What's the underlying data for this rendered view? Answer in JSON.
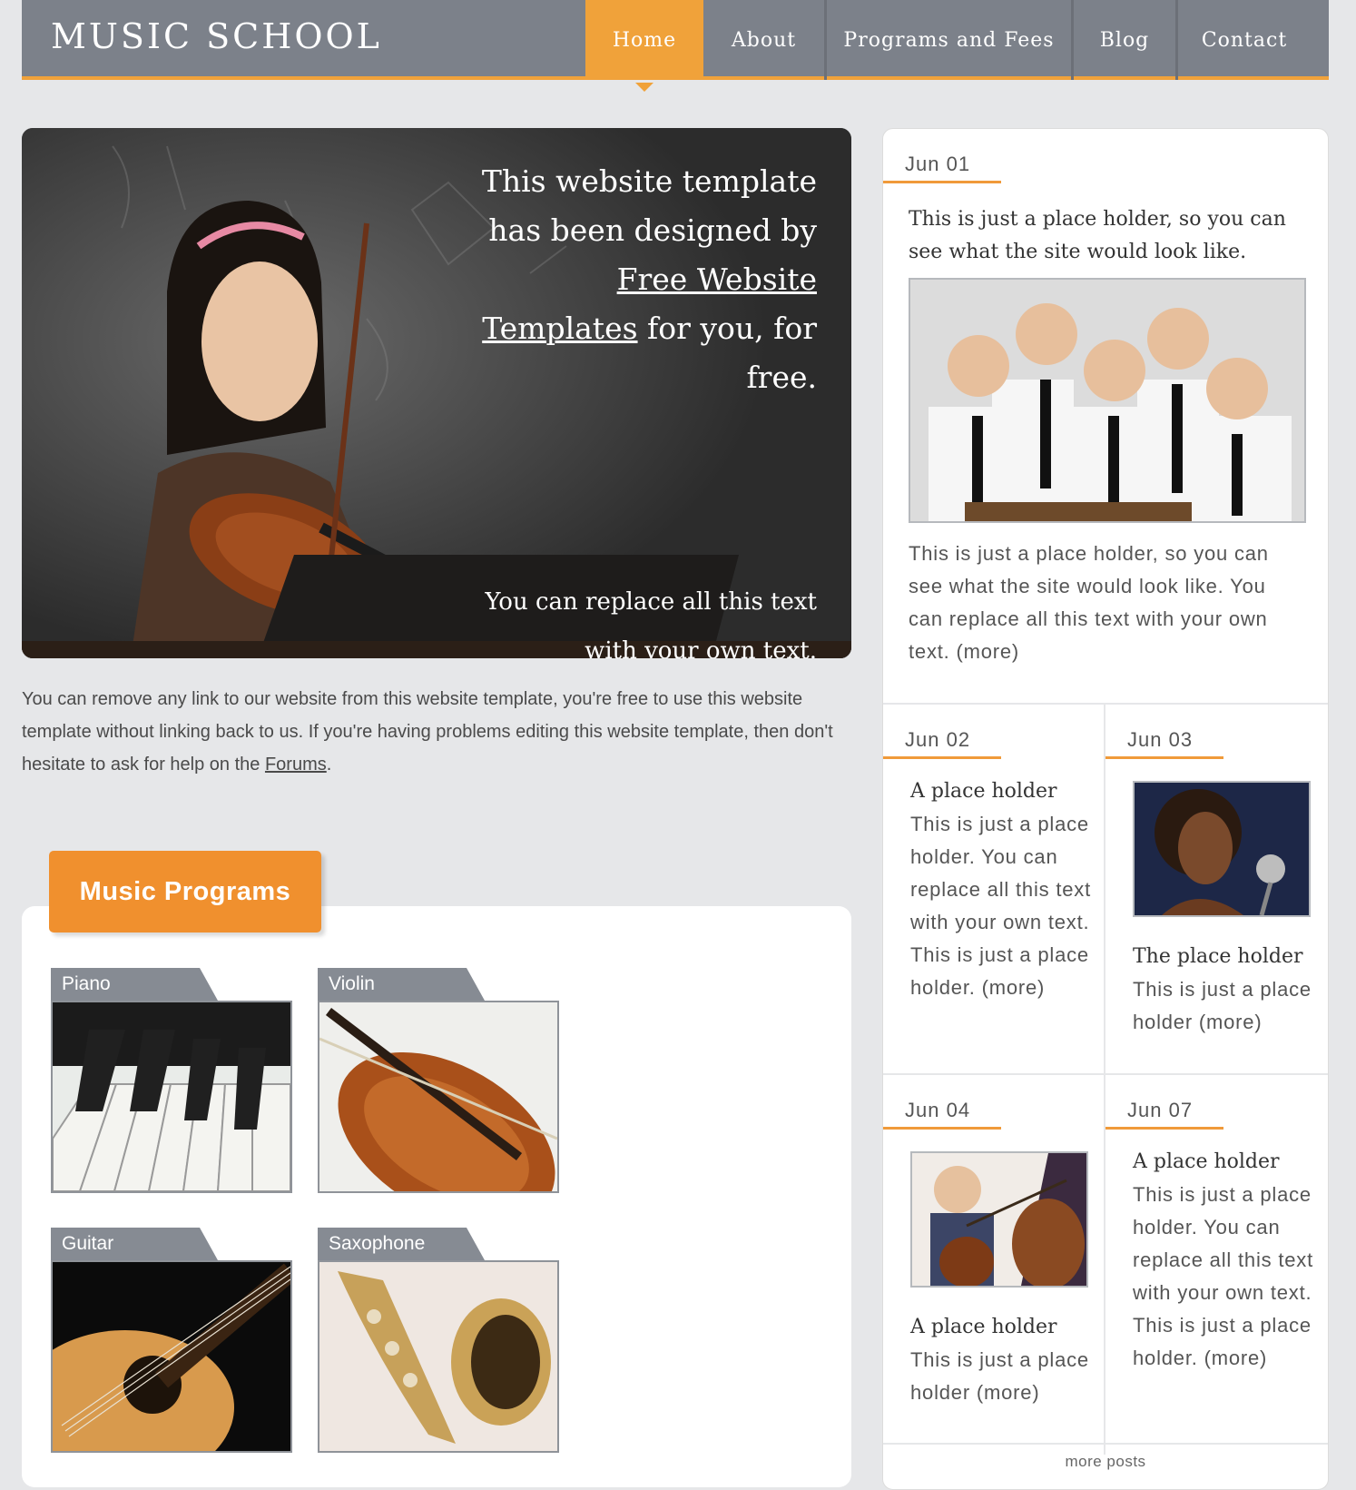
{
  "site": {
    "logo": "MUSIC SCHOOL"
  },
  "nav": [
    {
      "label": "Home",
      "active": true
    },
    {
      "label": "About"
    },
    {
      "label": "Programs and Fees"
    },
    {
      "label": "Blog"
    },
    {
      "label": "Contact"
    }
  ],
  "hero": {
    "line1": "This website template has been designed by",
    "link": "Free Website Templates",
    "line2": "for you, for free.",
    "sub": "You can replace all this text with your own text."
  },
  "intro": {
    "text": "You can remove any link to our website from this website template, you're free to use this website template without linking back to us. If you're having problems editing this website template, then don't hesitate to ask for help on the ",
    "link": "Forums",
    "end": "."
  },
  "programs": {
    "heading": "Music Programs",
    "items": [
      "Piano",
      "Violin",
      "Guitar",
      "Saxophone"
    ]
  },
  "sidebar": {
    "post1": {
      "date": "Jun 01",
      "title": "This is just a place holder, so you can see what the site would look like.",
      "body": "This is just a place holder, so you can see what the site would look like. You can replace all this text with your own text. (more)"
    },
    "post2": {
      "date": "Jun 02",
      "title": "A place holder",
      "body": "This is just a place holder. You can replace all this text with your own text. This is just a place holder. (more)"
    },
    "post3": {
      "date": "Jun 03",
      "title": "The place holder",
      "body": "This is just a place holder (more)"
    },
    "post4": {
      "date": "Jun 04",
      "title": "A place holder",
      "body": "This is just a place holder (more)"
    },
    "post5": {
      "date": "Jun 07",
      "title": "A place holder",
      "body": "This is just a place holder. You can replace all this text with your own text. This is just a place holder. (more)"
    },
    "more": "more posts"
  },
  "colors": {
    "accent": "#f0a23a",
    "header": "#7c818a",
    "background": "#e6e7e9"
  }
}
